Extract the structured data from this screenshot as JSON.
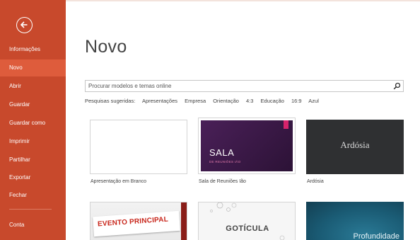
{
  "sidebar": {
    "back_icon": "back-arrow-icon",
    "items": [
      {
        "label": "Informações",
        "active": false
      },
      {
        "label": "Novo",
        "active": true
      },
      {
        "label": "Abrir",
        "active": false
      },
      {
        "label": "Guardar",
        "active": false
      },
      {
        "label": "Guardar como",
        "active": false
      },
      {
        "label": "Imprimir",
        "active": false
      },
      {
        "label": "Partilhar",
        "active": false
      },
      {
        "label": "Exportar",
        "active": false
      },
      {
        "label": "Fechar",
        "active": false
      },
      {
        "label": "Conta",
        "active": false
      }
    ]
  },
  "main": {
    "title": "Novo",
    "search": {
      "placeholder": "Procurar modelos e temas online",
      "icon": "search-icon"
    },
    "suggested": {
      "label": "Pesquisas sugeridas:",
      "items": [
        "Apresentações",
        "Empresa",
        "Orientação",
        "4:3",
        "Educação",
        "16:9",
        "Azul"
      ]
    },
    "templates": [
      {
        "label": "Apresentação em Branco"
      },
      {
        "label": "Sala de Reuniões Ião",
        "thumb_title": "SALA",
        "thumb_subtitle": "DE REUNIÕES IÃO"
      },
      {
        "label": "Ardósia",
        "thumb_title": "Ardósia"
      },
      {
        "thumb_title": "EVENTO PRINCIPAL"
      },
      {
        "thumb_title": "GOTÍCULA"
      },
      {
        "thumb_title": "Profundidade"
      }
    ]
  },
  "colors": {
    "sidebar_bg": "#c8492c",
    "sidebar_active": "#de5c3c",
    "sala_bg": "#3b1c4a",
    "sala_accent": "#d6236b",
    "ardosia_bg": "#2f3032",
    "evento_red": "#c8261b",
    "profundidade_bg": "#1a5b74"
  }
}
